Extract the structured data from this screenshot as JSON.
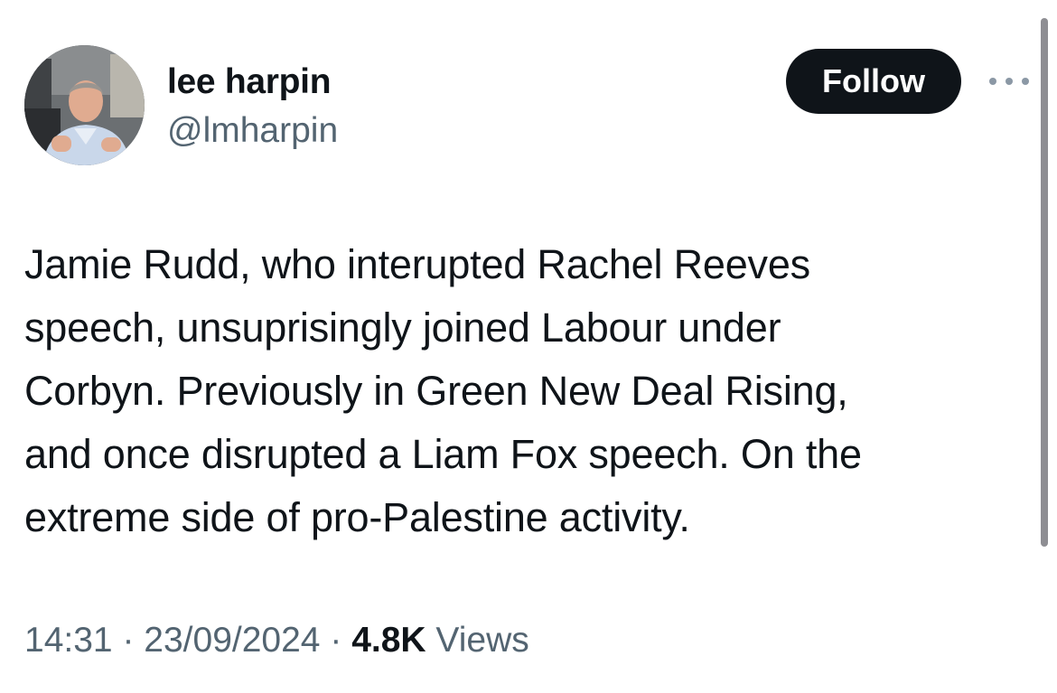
{
  "author": {
    "display_name": "lee harpin",
    "handle": "@lmharpin"
  },
  "actions": {
    "follow_label": "Follow",
    "more_icon": "more-horizontal-icon"
  },
  "tweet": {
    "text": "Jamie Rudd, who interupted Rachel Reeves\nspeech, unsuprisingly joined Labour under\nCorbyn.  Previously in Green New Deal Rising,\nand once disrupted a Liam Fox speech. On the\nextreme side of pro-Palestine activity.",
    "time": "14:31",
    "separator": "·",
    "date": "23/09/2024",
    "views_count": "4.8K",
    "views_label": "Views"
  },
  "colors": {
    "text_primary": "#0f1419",
    "text_secondary": "#536471",
    "follow_bg": "#0f1419",
    "follow_text": "#ffffff"
  }
}
